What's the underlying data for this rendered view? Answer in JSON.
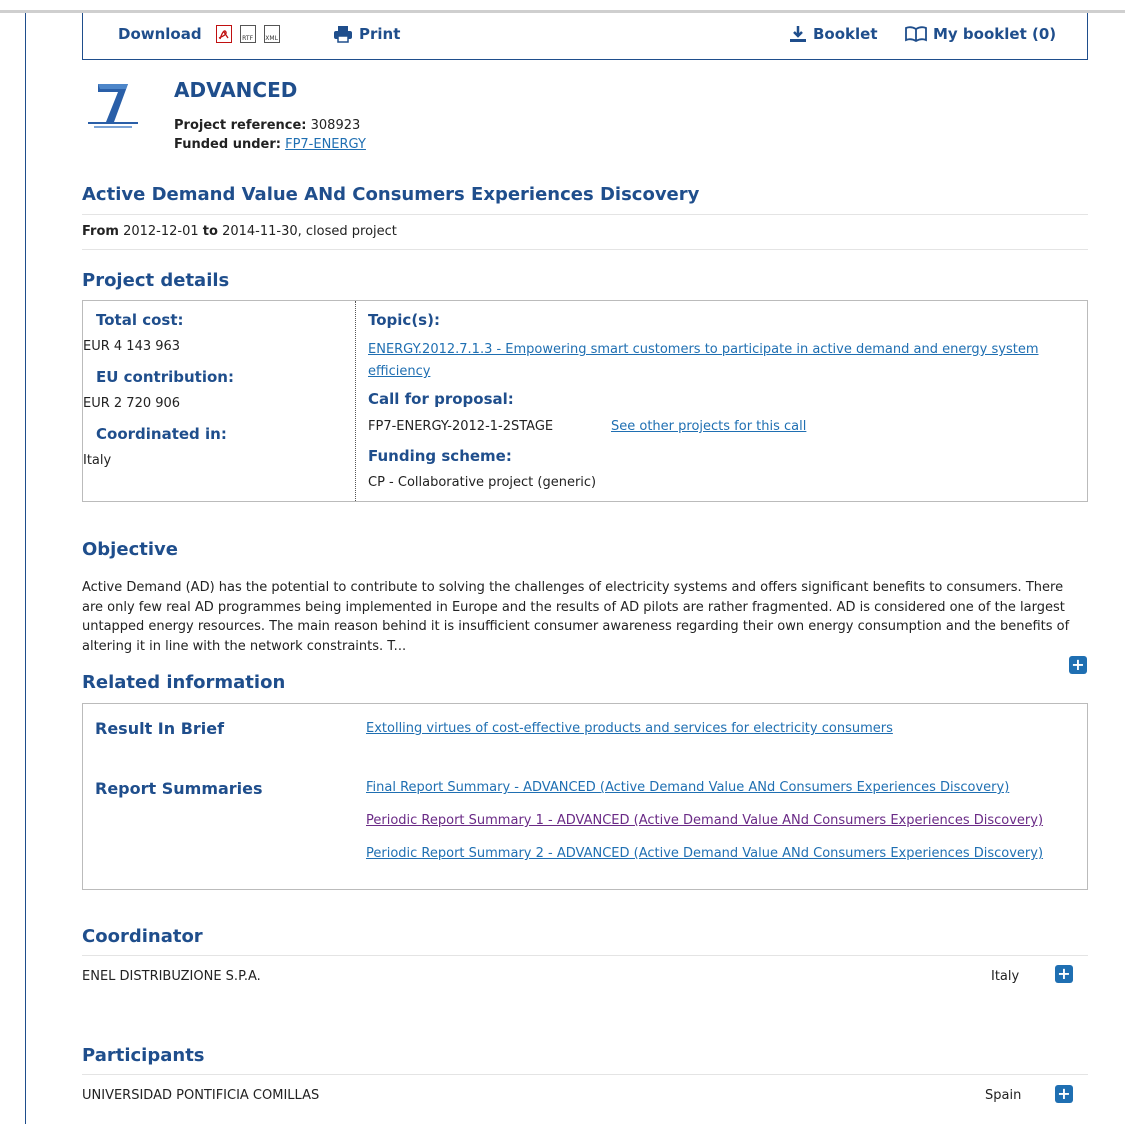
{
  "toolbar": {
    "download_label": "Download",
    "download_formats": [
      "PDF",
      "RTF",
      "XML"
    ],
    "print_label": "Print",
    "booklet_label": "Booklet",
    "my_booklet_label": "My booklet (0)"
  },
  "project": {
    "acronym": "ADVANCED",
    "reference_label": "Project reference:",
    "reference_value": "308923",
    "funded_label": "Funded under:",
    "funded_value": "FP7-ENERGY",
    "title": "Active Demand Value ANd Consumers Experiences Discovery",
    "dates": {
      "from_label": "From",
      "from": "2012-12-01",
      "to_label": "to",
      "to": "2014-11-30",
      "status": ", closed project"
    }
  },
  "details": {
    "heading": "Project details",
    "total_cost_label": "Total cost:",
    "total_cost": "EUR 4 143 963",
    "eu_contribution_label": "EU contribution:",
    "eu_contribution": "EUR 2 720 906",
    "coordinated_label": "Coordinated in:",
    "coordinated": "Italy",
    "topics_label": "Topic(s):",
    "topic_line1": "ENERGY.2012.7.1.3 - Empowering smart customers to participate in active demand and energy system",
    "topic_line2": "efficiency",
    "call_label": "Call for proposal:",
    "call_value": "FP7-ENERGY-2012-1-2STAGE",
    "call_link": "See other projects for this call",
    "funding_label": "Funding scheme:",
    "funding_value": "CP - Collaborative project (generic)"
  },
  "objective": {
    "heading": "Objective",
    "text": "Active Demand (AD) has the potential to contribute to solving the challenges of electricity systems and offers significant benefits to consumers. There are only few real AD programmes being implemented in Europe and the results of AD pilots are rather fragmented. AD is considered one of the largest untapped energy resources. The main reason behind it is insufficient consumer awareness regarding their own energy consumption and the benefits of altering it in line with the network constraints. T..."
  },
  "related": {
    "heading": "Related information",
    "result_label": "Result In Brief",
    "result_link": "Extolling virtues of cost-effective products and services for electricity consumers",
    "reports_label": "Report Summaries",
    "reports": [
      "Final Report Summary - ADVANCED (Active Demand Value ANd Consumers Experiences Discovery)",
      "Periodic Report Summary 1 - ADVANCED (Active Demand Value ANd Consumers Experiences Discovery)",
      "Periodic Report Summary 2 - ADVANCED (Active Demand Value ANd Consumers Experiences Discovery)"
    ]
  },
  "coordinator": {
    "heading": "Coordinator",
    "name": "ENEL DISTRIBUZIONE S.P.A.",
    "country": "Italy"
  },
  "participants": {
    "heading": "Participants",
    "name": "UNIVERSIDAD PONTIFICIA COMILLAS",
    "country": "Spain"
  },
  "colors": {
    "heading": "#1f4e8c",
    "link": "#1f6fb2",
    "visited": "#6a2a86"
  }
}
